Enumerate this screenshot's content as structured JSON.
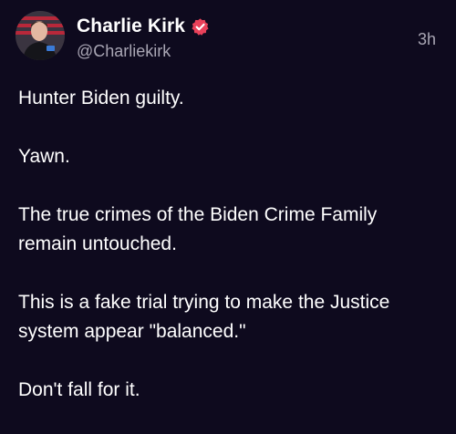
{
  "post": {
    "author": {
      "display_name": "Charlie Kirk",
      "handle": "@Charliekirk",
      "verified": true,
      "verified_icon": "verified-badge-icon",
      "verified_color": "#e8415a"
    },
    "timestamp": "3h",
    "paragraphs": [
      "Hunter Biden guilty.",
      "Yawn.",
      "The true crimes of the Biden Crime Family remain untouched.",
      "This is a fake trial trying to make the Justice system appear \"balanced.\"",
      "Don't fall for it."
    ]
  },
  "theme": {
    "background": "#0e0a1e",
    "text": "#ffffff",
    "muted_text": "#a9a6b4"
  }
}
